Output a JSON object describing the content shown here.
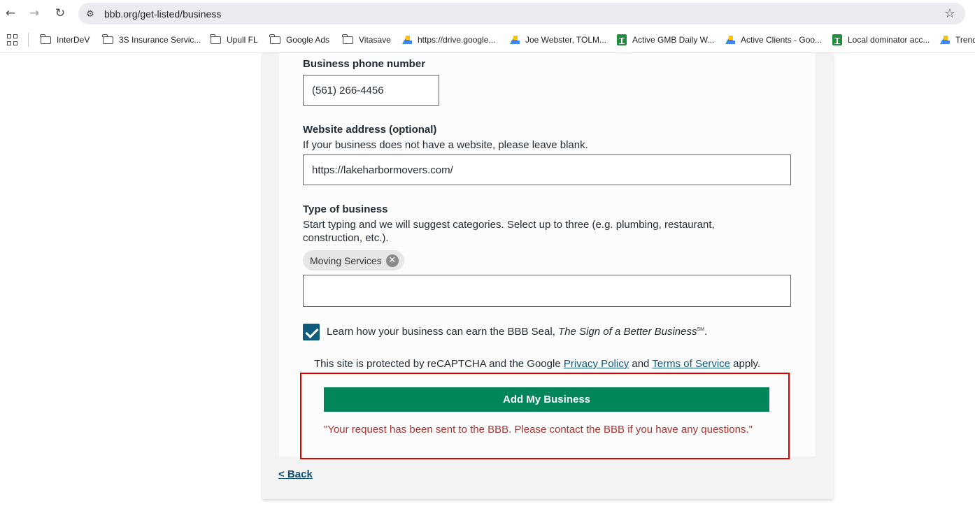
{
  "browser": {
    "url": "bbb.org/get-listed/business",
    "bookmarks": [
      {
        "label": "InterDeV",
        "icon": "folder-icon"
      },
      {
        "label": "3S Insurance Servic...",
        "icon": "folder-icon"
      },
      {
        "label": "Upull FL",
        "icon": "folder-icon"
      },
      {
        "label": "Google Ads",
        "icon": "folder-icon"
      },
      {
        "label": "Vitasave",
        "icon": "folder-icon"
      },
      {
        "label": "https://drive.google...",
        "icon": "google-drive-icon"
      },
      {
        "label": "Joe Webster, TOLM...",
        "icon": "google-drive-icon"
      },
      {
        "label": "Active GMB Daily W...",
        "icon": "google-sheets-icon"
      },
      {
        "label": "Active Clients - Goo...",
        "icon": "google-drive-icon"
      },
      {
        "label": "Local dominator acc...",
        "icon": "google-sheets-icon"
      },
      {
        "label": "Trend",
        "icon": "google-drive-icon"
      }
    ]
  },
  "form": {
    "phone": {
      "label": "Business phone number",
      "value": "(561) 266-4456"
    },
    "website": {
      "label": "Website address (optional)",
      "help": "If your business does not have a website, please leave blank.",
      "value": "https://lakeharbormovers.com/"
    },
    "type": {
      "label": "Type of business",
      "help": "Start typing and we will suggest categories. Select up to three (e.g. plumbing, restaurant, construction, etc.).",
      "chips": [
        "Moving Services"
      ],
      "value": ""
    },
    "seal": {
      "checked": true,
      "text_prefix": "Learn how your business can earn the BBB Seal, ",
      "text_italic": "The Sign of a Better Business",
      "text_mark": "SM",
      "text_suffix": "."
    },
    "recaptcha": {
      "prefix": "This site is protected by reCAPTCHA and the Google ",
      "privacy_link": "Privacy Policy",
      "middle": " and ",
      "terms_link": "Terms of Service",
      "suffix": " apply."
    },
    "submit_label": "Add My Business",
    "confirmation": "\"Your request has been sent to the BBB. Please contact the BBB if you have any questions.\"",
    "back_link": "< Back"
  }
}
